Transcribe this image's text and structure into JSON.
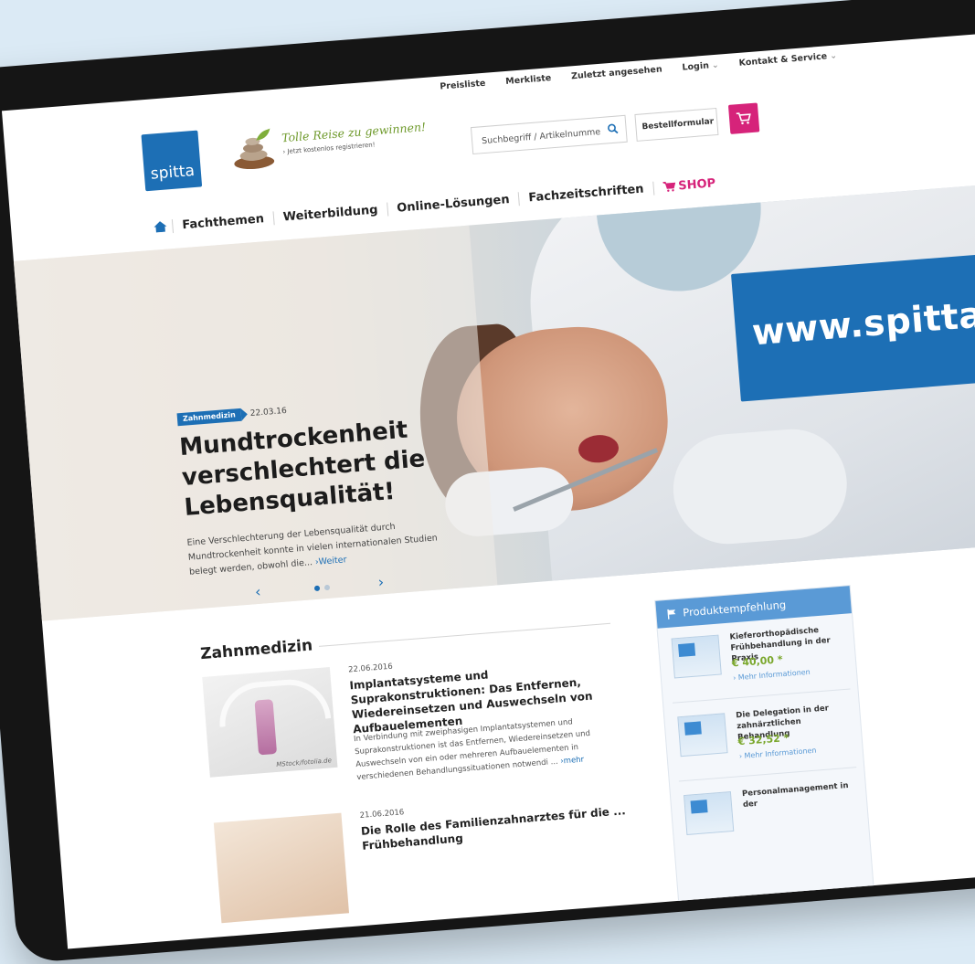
{
  "utility_nav": [
    {
      "label": "Preisliste",
      "caret": false
    },
    {
      "label": "Merkliste",
      "caret": false
    },
    {
      "label": "Zuletzt angesehen",
      "caret": false
    },
    {
      "label": "Login",
      "caret": true
    },
    {
      "label": "Kontakt & Service",
      "caret": true
    }
  ],
  "header": {
    "logo_text": "spitta",
    "promo_title": "Tolle Reise zu gewinnen!",
    "promo_sub": "› Jetzt kostenlos registrieren!",
    "search_placeholder": "Suchbegriff / Artikelnummer",
    "order_form_label": "Bestellformular",
    "order_form_arrow": "›"
  },
  "main_nav": {
    "items": [
      "Fachthemen",
      "Weiterbildung",
      "Online-Lösungen",
      "Fachzeitschriften"
    ],
    "shop_label": "SHOP"
  },
  "hero": {
    "category": "Zahnmedizin",
    "date": "22.03.16",
    "title": "Mundtrockenheit verschlechtert die Lebensqualität!",
    "text": "Eine Verschlechterung der Lebensqualität durch Mundtrockenheit konnte in vielen internationalen Studien belegt werden, obwohl die...",
    "more_link": "›Weiter",
    "prev": "‹",
    "next": "›",
    "slide_count": 2,
    "active_slide": 1
  },
  "section": {
    "title": "Zahnmedizin"
  },
  "articles": [
    {
      "date": "22.06.2016",
      "title": "Implantatsysteme und Suprakonstruktionen: Das Entfernen, Wiedereinsetzen und Auswechseln von Aufbauelementen",
      "text": "In Verbindung mit zweiphasigen Implantatsystemen und Suprakonstruktionen ist das Entfernen, Wiedereinsetzen und Auswechseln von ein oder mehreren Aufbauelementen in verschiedenen Behandlungssituationen notwendi ...",
      "more": "›mehr",
      "image_credit": "MStock/fotolia.de"
    },
    {
      "date": "21.06.2016",
      "title": "Die Rolle des Familienzahnarztes für die ... Frühbehandlung",
      "text": "",
      "more": "",
      "image_credit": ""
    }
  ],
  "sidebar": {
    "title": "Produktempfehlung",
    "products": [
      {
        "name": "Kieferorthopädische Frühbehandlung in der Praxis",
        "price": "€ 40,00 *",
        "more": "› Mehr Informationen"
      },
      {
        "name": "Die Delegation in der zahnärztlichen Behandlung",
        "price": "€ 32,52 *",
        "more": "› Mehr Informationen"
      },
      {
        "name": "Personalmanagement in der",
        "price": "",
        "more": ""
      }
    ]
  },
  "url_badge": "www.spitta.de",
  "colors": {
    "brand_blue": "#1d6fb5",
    "shop_magenta": "#d6237a",
    "price_green": "#7aa72c",
    "sidebar_head": "#5a9ad6"
  }
}
